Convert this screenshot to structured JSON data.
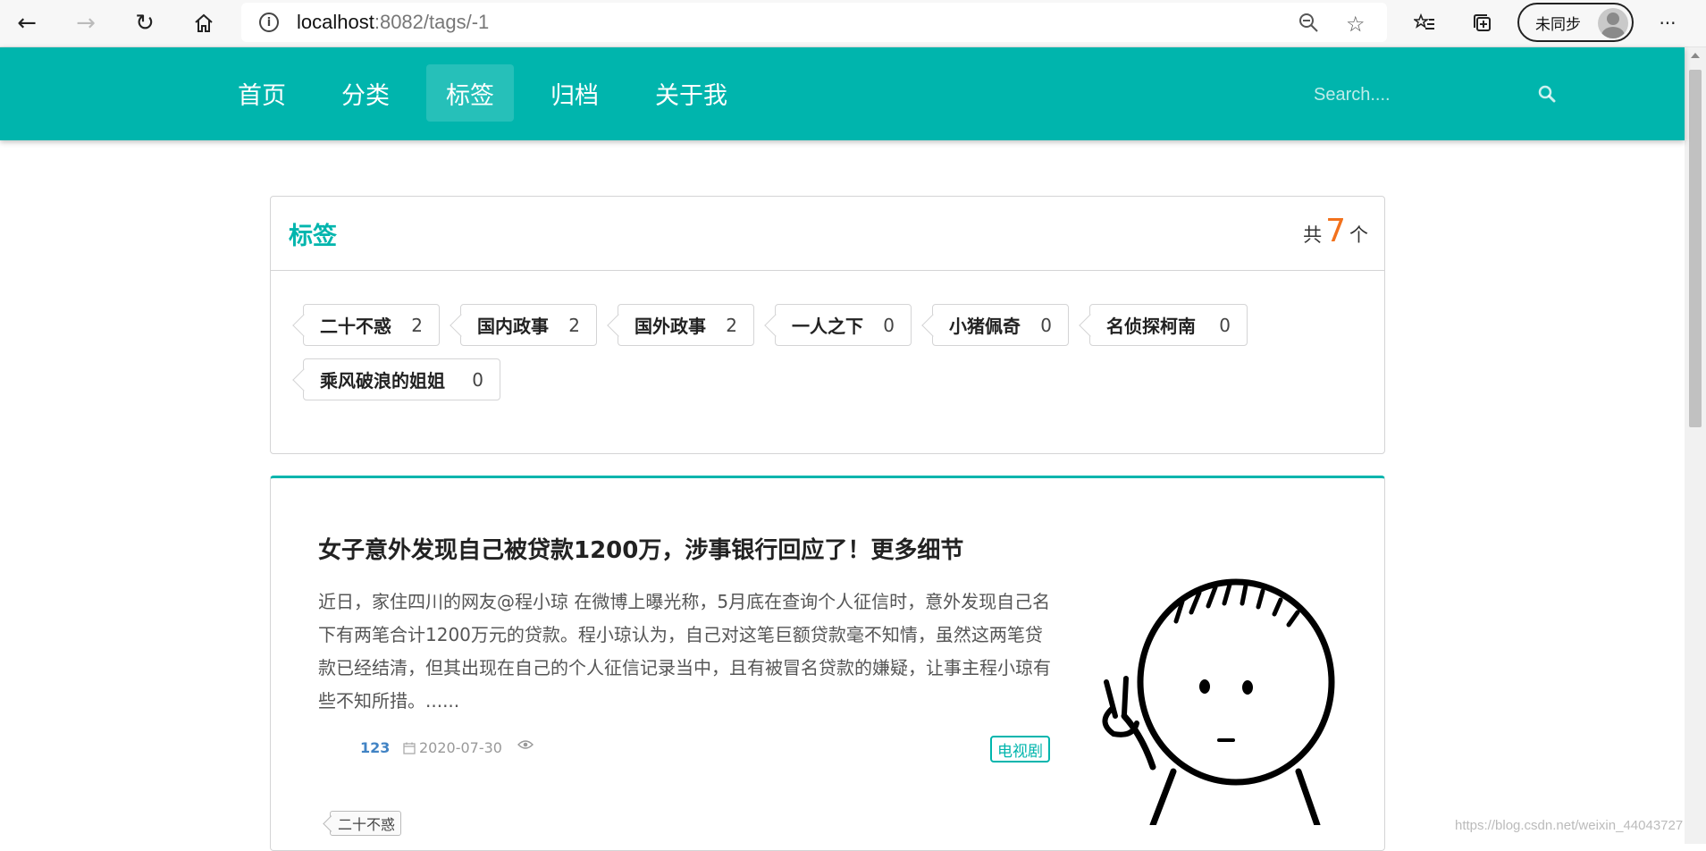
{
  "browser": {
    "url_host": "localhost",
    "url_rest": ":8082/tags/-1",
    "sync_label": "未同步",
    "more_label": "···"
  },
  "nav": {
    "items": [
      {
        "label": "首页",
        "active": false
      },
      {
        "label": "分类",
        "active": false
      },
      {
        "label": "标签",
        "active": true
      },
      {
        "label": "归档",
        "active": false
      },
      {
        "label": "关于我",
        "active": false
      }
    ],
    "search_placeholder": "Search...."
  },
  "tags_panel": {
    "title": "标签",
    "count_prefix": "共",
    "count": "7",
    "count_suffix": "个",
    "tags": [
      {
        "name": "二十不惑",
        "count": "2"
      },
      {
        "name": "国内政事",
        "count": "2"
      },
      {
        "name": "国外政事",
        "count": "2"
      },
      {
        "name": "一人之下",
        "count": "0"
      },
      {
        "name": "小猪佩奇",
        "count": "0"
      },
      {
        "name": "名侦探柯南",
        "count": "0"
      },
      {
        "name": "乘风破浪的姐姐",
        "count": "0"
      }
    ]
  },
  "article": {
    "title": "女子意外发现自己被贷款1200万，涉事银行回应了！更多细节",
    "summary": "近日，家住四川的网友@程小琼 在微博上曝光称，5月底在查询个人征信时，意外发现自己名下有两笔合计1200万元的贷款。程小琼认为，自己对这笔巨额贷款毫不知情，虽然这两笔贷款已经结清，但其出现在自己的个人征信记录当中，且有被冒名贷款的嫌疑，让事主程小琼有些不知所措。......",
    "author": "123",
    "date": "2020-07-30",
    "type": "电视剧",
    "tag": "二十不惑"
  },
  "watermark": "https://blog.csdn.net/weixin_44043727",
  "colors": {
    "accent": "#00b5ad",
    "count_orange": "#f2711c",
    "author_blue": "#4183c4"
  }
}
